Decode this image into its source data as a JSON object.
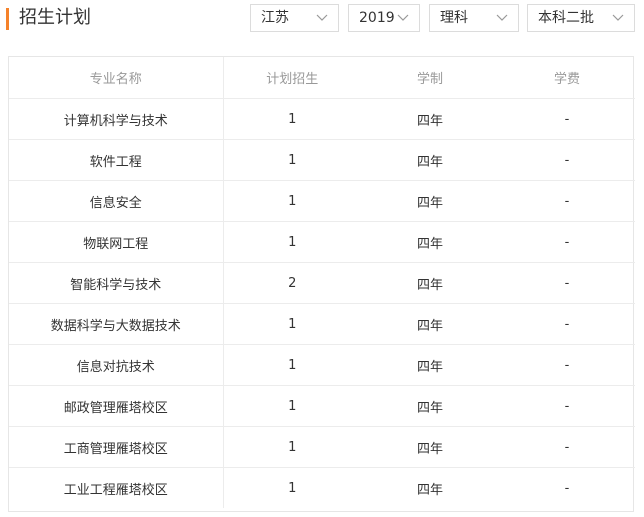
{
  "header": {
    "title": "招生计划"
  },
  "filters": [
    {
      "value": "江苏",
      "icon": "chevron-down-icon"
    },
    {
      "value": "2019",
      "icon": "chevron-down-icon"
    },
    {
      "value": "理科",
      "icon": "chevron-down-icon"
    },
    {
      "value": "本科二批",
      "icon": "chevron-down-icon"
    }
  ],
  "table": {
    "headers": [
      "专业名称",
      "计划招生",
      "学制",
      "学费"
    ],
    "rows": [
      [
        "计算机科学与技术",
        "1",
        "四年",
        "-"
      ],
      [
        "软件工程",
        "1",
        "四年",
        "-"
      ],
      [
        "信息安全",
        "1",
        "四年",
        "-"
      ],
      [
        "物联网工程",
        "1",
        "四年",
        "-"
      ],
      [
        "智能科学与技术",
        "2",
        "四年",
        "-"
      ],
      [
        "数据科学与大数据技术",
        "1",
        "四年",
        "-"
      ],
      [
        "信息对抗技术",
        "1",
        "四年",
        "-"
      ],
      [
        "邮政管理雁塔校区",
        "1",
        "四年",
        "-"
      ],
      [
        "工商管理雁塔校区",
        "1",
        "四年",
        "-"
      ],
      [
        "工业工程雁塔校区",
        "1",
        "四年",
        "-"
      ]
    ]
  },
  "colors": {
    "accent": "#f5822a",
    "header_text": "#999999",
    "border": "#e6e6e6"
  }
}
